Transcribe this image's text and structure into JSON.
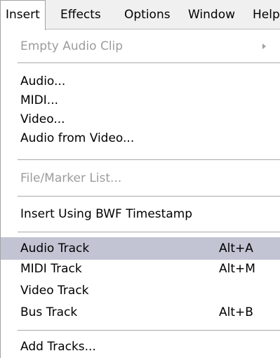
{
  "menubar": {
    "items": [
      {
        "label": "Insert"
      },
      {
        "label": "Effects"
      },
      {
        "label": "Options"
      },
      {
        "label": "Window"
      },
      {
        "label": "Help"
      }
    ],
    "active_index": 0
  },
  "dropdown": {
    "empty_audio_clip": {
      "label": "Empty Audio Clip",
      "icon": "submenu-arrow-icon"
    },
    "audio": {
      "label": "Audio..."
    },
    "midi": {
      "label": "MIDI..."
    },
    "video": {
      "label": "Video..."
    },
    "audio_from_video": {
      "label": "Audio from Video..."
    },
    "file_marker_list": {
      "label": "File/Marker List..."
    },
    "insert_bwf": {
      "label": "Insert Using BWF Timestamp"
    },
    "audio_track": {
      "label": "Audio Track",
      "shortcut": "Alt+A"
    },
    "midi_track": {
      "label": "MIDI Track",
      "shortcut": "Alt+M"
    },
    "video_track": {
      "label": "Video Track"
    },
    "bus_track": {
      "label": "Bus Track",
      "shortcut": "Alt+B"
    },
    "add_tracks": {
      "label": "Add Tracks..."
    }
  },
  "colors": {
    "menubar_bg": "#f0f0f0",
    "highlight_bg": "#c2c3d3",
    "disabled_text": "#9c9c9c",
    "separator": "#a9a9a9"
  }
}
